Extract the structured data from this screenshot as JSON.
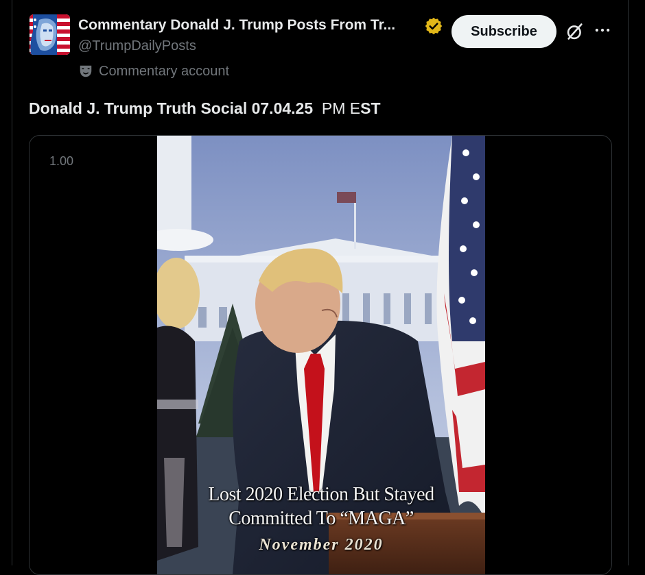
{
  "post": {
    "author_name": "Commentary Donald J. Trump Posts From Tr...",
    "handle": "@TrumpDailyPosts",
    "account_label": "Commentary account",
    "subscribe_label": "Subscribe",
    "text_bold": "Donald J. Trump Truth Social 07.04.25",
    "text_pm": "PM E",
    "text_st": "ST"
  },
  "media": {
    "speed": "1.00",
    "captions": {
      "line1": "Lost 2020 Election But Stayed",
      "line2": "Committed To “MAGA”",
      "line3": "November 2020"
    }
  },
  "icons": {
    "verified": "verified-badge-icon",
    "mask": "theater-mask-icon",
    "grok": "grok-icon",
    "more": "more-options-icon"
  },
  "colors": {
    "background": "#000000",
    "text_primary": "#e7e9ea",
    "text_secondary": "#71767b",
    "verified_gold": "#e2b719",
    "button_bg": "#eff3f4"
  }
}
